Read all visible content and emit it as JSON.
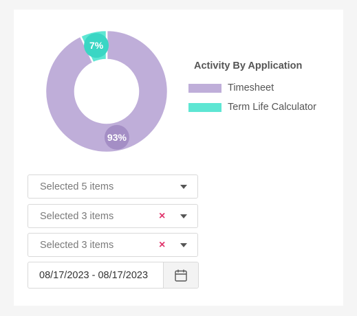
{
  "chart_data": {
    "type": "pie",
    "title": "Activity By Application",
    "categories": [
      "Timesheet",
      "Term Life Calculator"
    ],
    "values": [
      93,
      7
    ],
    "labels": [
      "93%",
      "7%"
    ],
    "colors": [
      "#bfaed9",
      "#5ee6d3"
    ],
    "label_badge_colors": [
      "#a48ec5",
      "#3ad6c4"
    ],
    "legend_position": "right"
  },
  "filters": [
    {
      "text": "Selected 5 items",
      "clearable": false
    },
    {
      "text": "Selected 3 items",
      "clearable": true
    },
    {
      "text": "Selected 3 items",
      "clearable": true
    }
  ],
  "date_range": {
    "value": "08/17/2023 - 08/17/2023"
  },
  "icons": {
    "clear": "×",
    "calendar": "calendar-icon",
    "dropdown": "chevron-down-icon"
  }
}
